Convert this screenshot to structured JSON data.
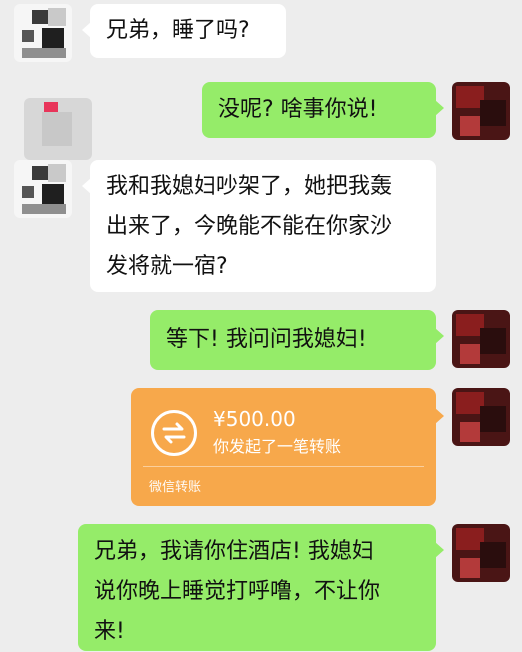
{
  "messages": [
    {
      "side": "left",
      "text": "兄弟，睡了吗?"
    },
    {
      "side": "right",
      "text": "没呢? 啥事你说!"
    },
    {
      "side": "left",
      "lines": [
        "我和我媳妇吵架了，她把我轰",
        "出来了，今晚能不能在你家沙",
        "发将就一宿?"
      ]
    },
    {
      "side": "right",
      "text": "等下! 我问问我媳妇!"
    },
    {
      "side": "right",
      "lines": [
        "兄弟，我请你住酒店! 我媳妇",
        "说你晚上睡觉打呼噜，不让你",
        "来!"
      ]
    }
  ],
  "transfer": {
    "amount": "¥500.00",
    "description": "你发起了一笔转账",
    "footer": "微信转账",
    "color": "#f7a84b"
  },
  "colors": {
    "background": "#ededed",
    "left_bubble": "#ffffff",
    "right_bubble": "#95ec69"
  }
}
